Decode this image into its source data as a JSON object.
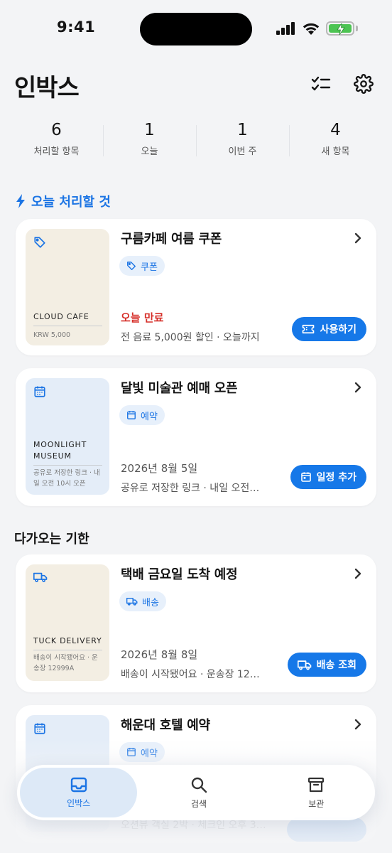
{
  "status_bar": {
    "time": "9:41"
  },
  "header": {
    "title": "인박스"
  },
  "stats": [
    {
      "value": "6",
      "label": "처리할 항목"
    },
    {
      "value": "1",
      "label": "오늘"
    },
    {
      "value": "1",
      "label": "이번 주"
    },
    {
      "value": "4",
      "label": "새 항목"
    }
  ],
  "sections": {
    "today": "오늘 처리할 것",
    "upcoming": "다가오는 기한"
  },
  "cards": [
    {
      "thumb_title": "CLOUD CAFE",
      "thumb_sub": "KRW 5,000",
      "title": "구름카페 여름 쿠폰",
      "chip": "쿠폰",
      "meta1": "오늘 만료",
      "meta2": "전 음료 5,000원 할인 · 오늘까지",
      "action": "사용하기"
    },
    {
      "thumb_title": "MOONLIGHT MUSEUM",
      "thumb_sub": "공유로 저장한 링크 · 내일 오전 10시 오픈",
      "title": "달빛 미술관 예매 오픈",
      "chip": "예약",
      "meta1": "2026년 8월 5일",
      "meta2": "공유로 저장한 링크 · 내일 오전…",
      "action": "일정 추가"
    },
    {
      "thumb_title": "TUCK DELIVERY",
      "thumb_sub": "배송이 시작됐어요 · 운송장 12999A",
      "title": "택배 금요일 도착 예정",
      "chip": "배송",
      "meta1": "2026년 8월 8일",
      "meta2": "배송이 시작됐어요 · 운송장 12…",
      "action": "배송 조회"
    },
    {
      "title": "해운대 호텔 예약",
      "chip": "예약",
      "meta2": "오션뷰 객실 2박 · 체크인 오후 3…"
    }
  ],
  "bottom_nav": [
    {
      "label": "인박스",
      "icon": "inbox-icon"
    },
    {
      "label": "검색",
      "icon": "search-icon"
    },
    {
      "label": "보관",
      "icon": "archive-icon"
    }
  ],
  "colors": {
    "accent": "#1678e8",
    "danger": "#d6302a",
    "background": "#f3f4f6"
  }
}
